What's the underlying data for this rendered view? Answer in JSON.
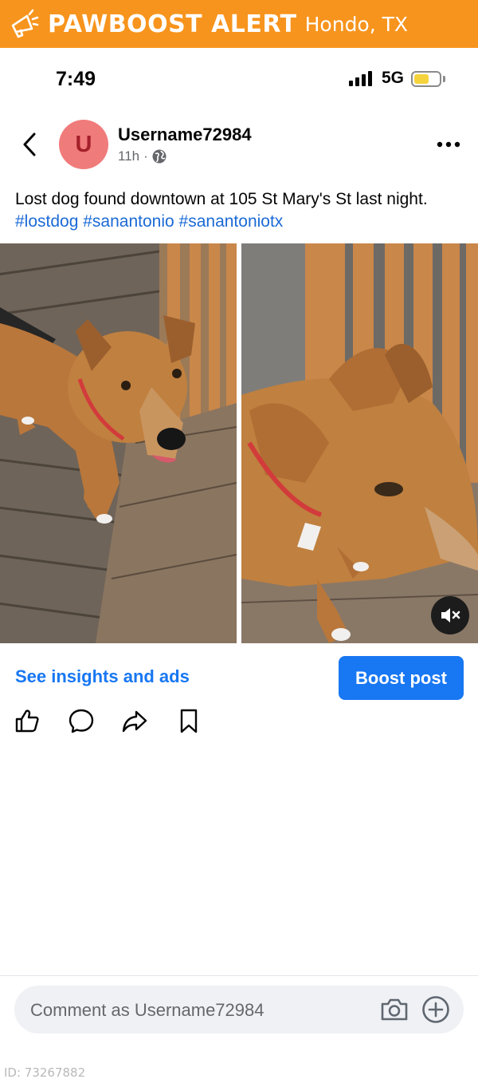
{
  "banner": {
    "brand": "PAWBOOST ALERT",
    "location": "Hondo, TX",
    "color": "#f7941d",
    "icon": "megaphone-icon"
  },
  "status_bar": {
    "time": "7:49",
    "network": "5G",
    "battery_fraction": 0.6,
    "battery_color": "#f5d33d"
  },
  "post": {
    "avatar_letter": "U",
    "avatar_color": "#f07b7b",
    "username": "Username72984",
    "time_ago": "11h",
    "separator": "·",
    "audience_icon": "globe-icon",
    "text_plain": "Lost dog found downtown at 105 St Mary's St last night.",
    "hashtags": [
      "#lostdog",
      "#sanantonio",
      "#sanantoniotx"
    ],
    "hashtag_color": "#1b6ad6"
  },
  "actions": {
    "insights_label": "See insights and ads",
    "boost_label": "Boost post",
    "accent_color": "#1877f2",
    "reaction_icons": [
      "like-icon",
      "comment-icon",
      "share-icon",
      "save-icon"
    ]
  },
  "comment": {
    "placeholder": "Comment as Username72984"
  },
  "footer": {
    "listing_id": "ID: 73267882"
  }
}
